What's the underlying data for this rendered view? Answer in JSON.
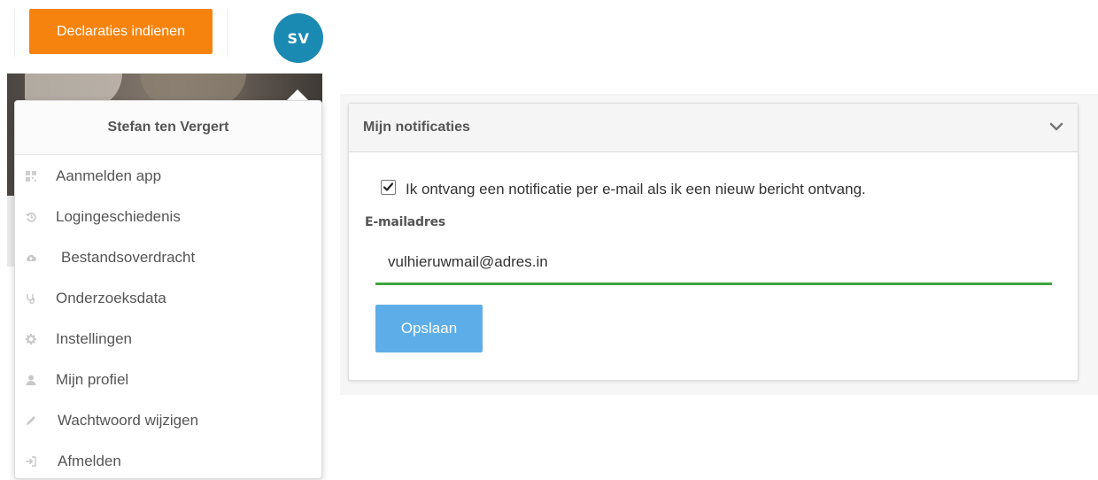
{
  "topbar": {
    "declare_label": "Declaraties indienen",
    "avatar_initials": "SV"
  },
  "user_menu": {
    "user_name": "Stefan ten Vergert",
    "items": [
      {
        "label": "Aanmelden app",
        "icon": "qr-grid-icon"
      },
      {
        "label": "Logingeschiedenis",
        "icon": "history-icon"
      },
      {
        "label": "Bestandsoverdracht",
        "icon": "cloud-upload-icon"
      },
      {
        "label": "Onderzoeksdata",
        "icon": "stethoscope-icon"
      },
      {
        "label": "Instellingen",
        "icon": "gear-icon"
      },
      {
        "label": "Mijn profiel",
        "icon": "user-icon"
      },
      {
        "label": "Wachtwoord wijzigen",
        "icon": "pencil-icon"
      },
      {
        "label": "Afmelden",
        "icon": "sign-out-icon"
      }
    ]
  },
  "notifications": {
    "title": "Mijn notificaties",
    "checkbox_checked": true,
    "checkbox_label": "Ik ontvang een notificatie per e-mail als ik een nieuw bericht ontvang.",
    "email_label": "E-mailadres",
    "email_value": "vulhieruwmail@adres.in",
    "save_label": "Opslaan"
  },
  "colors": {
    "declare_button": "#f7830f",
    "avatar": "#1a8ab3",
    "input_underline": "#3ea33e",
    "save_button": "#5daee8"
  }
}
